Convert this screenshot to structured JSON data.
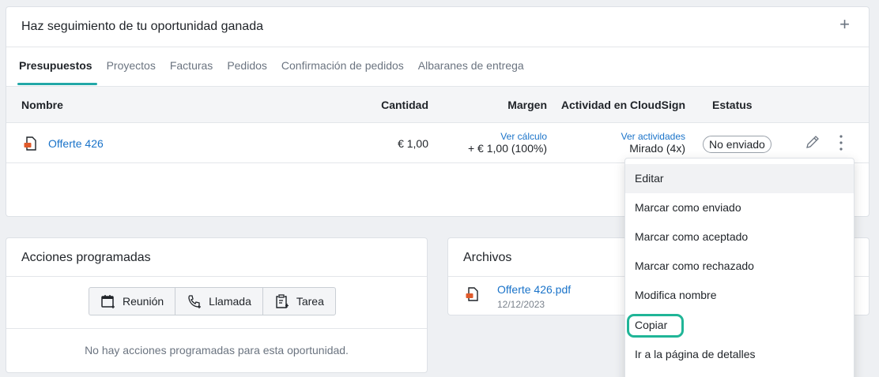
{
  "top_card": {
    "title": "Haz seguimiento de tu oportunidad ganada",
    "add_label": "+",
    "tabs": [
      {
        "label": "Presupuestos",
        "active": true
      },
      {
        "label": "Proyectos"
      },
      {
        "label": "Facturas"
      },
      {
        "label": "Pedidos"
      },
      {
        "label": "Confirmación de pedidos"
      },
      {
        "label": "Albaranes de entrega"
      }
    ],
    "columns": {
      "name": "Nombre",
      "amount": "Cantidad",
      "margin": "Margen",
      "activity": "Actividad en CloudSign",
      "status": "Estatus"
    },
    "row": {
      "name": "Offerte 426",
      "amount": "€ 1,00",
      "margin_link": "Ver cálculo",
      "margin_value": "+ € 1,00 (100%)",
      "activity_link": "Ver actividades",
      "activity_value": "Mirado (4x)",
      "status": "No enviado"
    }
  },
  "scheduled": {
    "title": "Acciones programadas",
    "buttons": [
      "Reunión",
      "Llamada",
      "Tarea"
    ],
    "empty": "No hay acciones programadas para esta oportunidad."
  },
  "files": {
    "title": "Archivos",
    "file_name": "Offerte 426.pdf",
    "file_date": "12/12/2023"
  },
  "menu": {
    "items": [
      "Editar",
      "Marcar como enviado",
      "Marcar como aceptado",
      "Marcar como rechazado",
      "Modifica nombre",
      "Copiar",
      "Ir a la página de detalles"
    ],
    "hovered_index": 0,
    "highlighted_index": 5
  },
  "colors": {
    "accent": "#22a8a8",
    "link": "#1a73c9",
    "highlight": "#20b597",
    "doc_icon": "#e05a2b"
  }
}
